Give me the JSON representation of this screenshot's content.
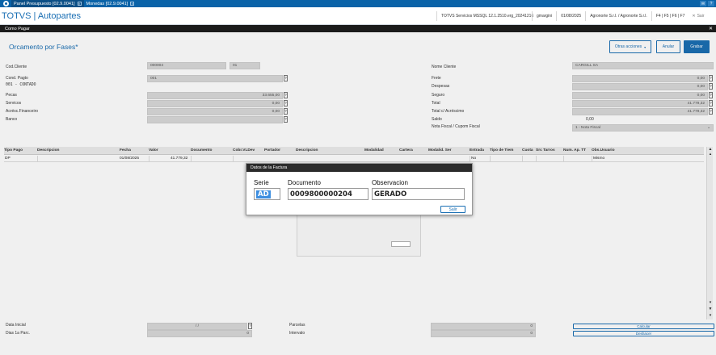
{
  "tabs": [
    {
      "label": "Panel Presupuesto [02.9.0041]",
      "active": true
    },
    {
      "label": "Monedas [02.9.0041]",
      "active": false
    }
  ],
  "header": {
    "brand": "TOTVS | Autopartes",
    "env": "TOTVS Servicios MSSQL 12.1.2510.erg_20241216",
    "user": "gmargini",
    "date": "01/08/2025",
    "company": "Agronorte S.r.l. / Agronorte S.r.l.",
    "shortcuts": "F4 | F5 | F6 | F7",
    "exit": "Sair"
  },
  "window": {
    "title": "Como Pagar"
  },
  "form": {
    "title": "Orcamento por Fases*",
    "buttons": {
      "more": "Otras acciones",
      "cancel": "Anular",
      "save": "Grabar"
    },
    "left": {
      "cod_cliente": {
        "label": "Cod.Cliente",
        "value": "000004",
        "loja": "01"
      },
      "cond_pago": {
        "label": "Cond. Pagto",
        "value": "001",
        "desc": "001 - CONTADO"
      },
      "pecas": {
        "label": "Pecas",
        "value": "33.655,00"
      },
      "servicos": {
        "label": "Servicos",
        "value": "0,00"
      },
      "acres_fin": {
        "label": "Acrésc.Financeiro",
        "value": "0,00"
      },
      "banco": {
        "label": "Banco",
        "value": ""
      }
    },
    "right": {
      "nome_cliente": {
        "label": "Nome Cliente",
        "value": "CARGILL SA"
      },
      "frete": {
        "label": "Frete",
        "value": "0,00"
      },
      "despesas": {
        "label": "Despesas",
        "value": "0,00"
      },
      "seguro": {
        "label": "Seguro",
        "value": "0,00"
      },
      "total": {
        "label": "Total",
        "value": "41.779,32"
      },
      "total_acres": {
        "label": "Total c/ Acréscimo",
        "value": "41.779,32"
      },
      "saldo": {
        "label": "Saldo",
        "value": "0,00"
      },
      "nota_fiscal": {
        "label": "Nota Fiscal / Cupom Fiscal",
        "value": "1 - Nota Fiscal"
      }
    }
  },
  "grid": {
    "columns": [
      "Tipo Pago",
      "Descripcion",
      "Fecha",
      "Valor",
      "Documento",
      "Cobr.VLDev",
      "Portador",
      "Descripcion",
      "Modalidad",
      "Cartera",
      "Modalid. Ser",
      "Entrada",
      "Tipo de Tiem",
      "Cuota",
      "Src Tarros",
      "Num. Ap. TT",
      "Obs.Usuario"
    ],
    "rows": [
      {
        "tipo": "DP",
        "fecha": "01/08/2025",
        "valor": "41.779,32",
        "entrada": "No",
        "obs": "Mismo"
      }
    ]
  },
  "dialog": {
    "title": "Datos de la Factura",
    "serie": {
      "label": "Serie",
      "value": "AD"
    },
    "documento": {
      "label": "Documento",
      "value": "0009800000204"
    },
    "observacion": {
      "label": "Observacion",
      "value": "GERADO"
    },
    "exit": "Salir"
  },
  "footer": {
    "data_inicial": {
      "label": "Data Inicial",
      "value": "/ /"
    },
    "dias_1a": {
      "label": "Dias 1a Parc.",
      "value": "0"
    },
    "parcelas": {
      "label": "Parcelas",
      "value": "0"
    },
    "intervalo": {
      "label": "Intervalo",
      "value": "0"
    },
    "calcular": "Calcular",
    "deshacer": "Deshacer"
  },
  "colors": {
    "brand": "#1a6fb4",
    "topbar": "#0a63a8"
  }
}
